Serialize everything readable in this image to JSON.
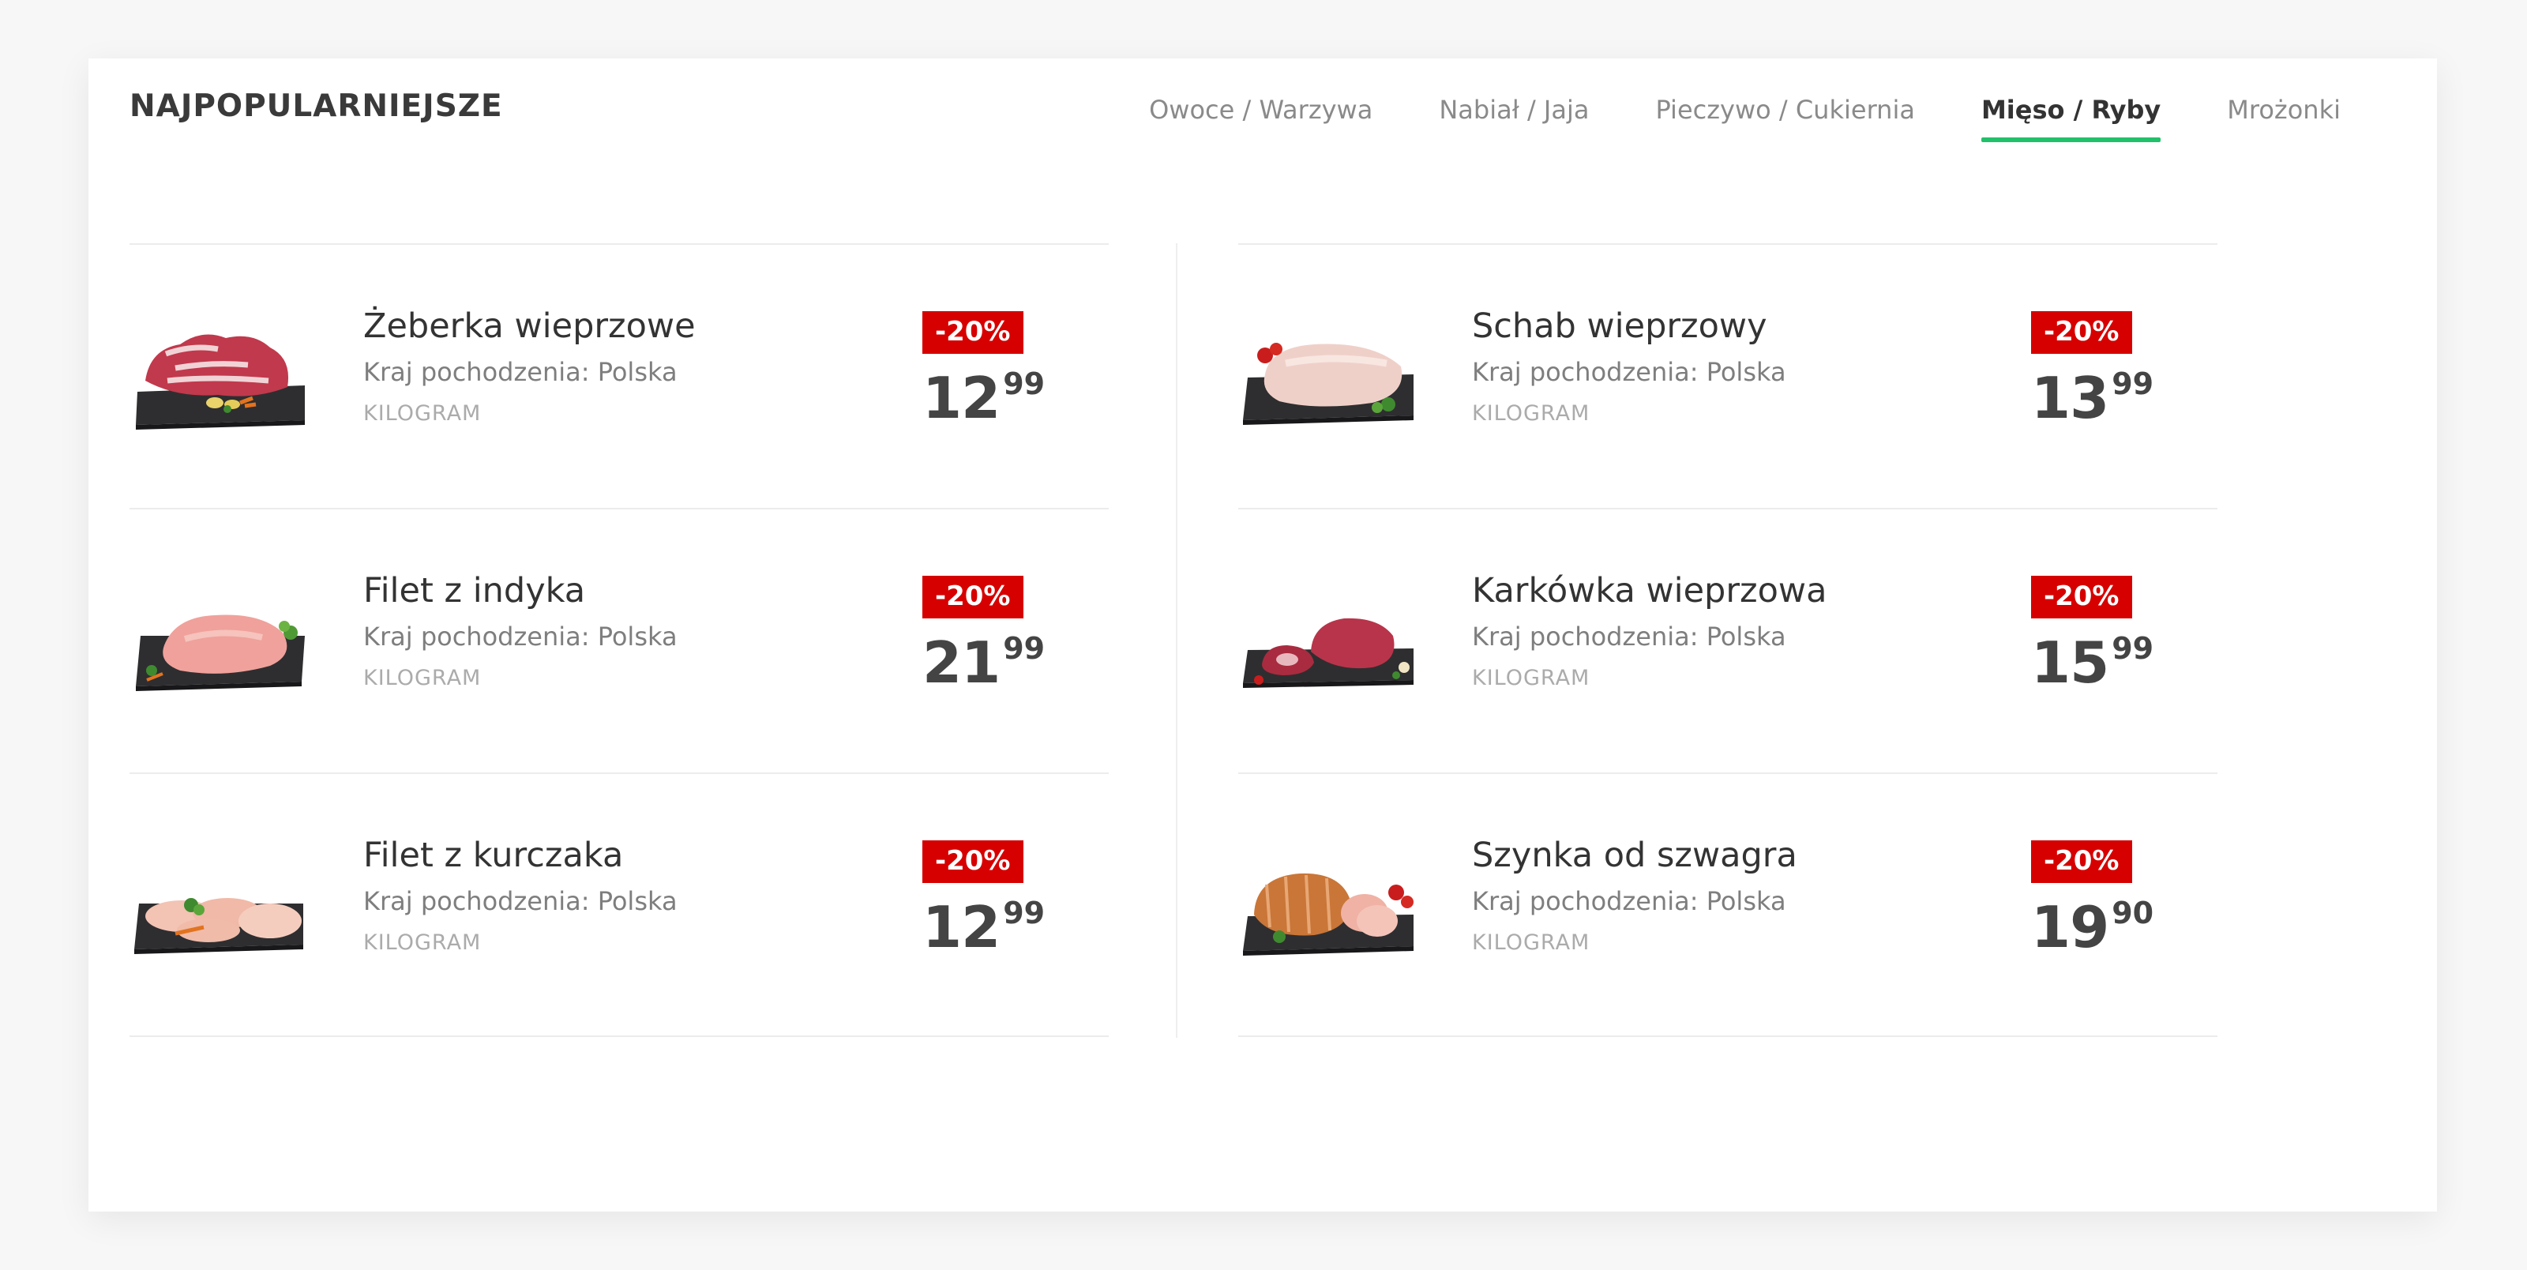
{
  "section_title": "NAJPOPULARNIEJSZE",
  "tabs": [
    {
      "label": "Owoce / Warzywa",
      "active": false
    },
    {
      "label": "Nabiał / Jaja",
      "active": false
    },
    {
      "label": "Pieczywo / Cukiernia",
      "active": false
    },
    {
      "label": "Mięso / Ryby",
      "active": true
    },
    {
      "label": "Mrożonki",
      "active": false
    }
  ],
  "colors": {
    "accent": "#22c06b",
    "badge": "#d60000",
    "text_dark": "#333333"
  },
  "products": [
    {
      "name": "Żeberka wieprzowe",
      "origin": "Kraj pochodzenia: Polska",
      "unit": "KILOGRAM",
      "discount": "-20%",
      "price_main": "12",
      "price_cents": "99",
      "image": "pork-ribs-image"
    },
    {
      "name": "Filet z indyka",
      "origin": "Kraj pochodzenia: Polska",
      "unit": "KILOGRAM",
      "discount": "-20%",
      "price_main": "21",
      "price_cents": "99",
      "image": "turkey-fillet-image"
    },
    {
      "name": "Filet z kurczaka",
      "origin": "Kraj pochodzenia: Polska",
      "unit": "KILOGRAM",
      "discount": "-20%",
      "price_main": "12",
      "price_cents": "99",
      "image": "chicken-fillet-image"
    },
    {
      "name": "Schab wieprzowy",
      "origin": "Kraj pochodzenia: Polska",
      "unit": "KILOGRAM",
      "discount": "-20%",
      "price_main": "13",
      "price_cents": "99",
      "image": "pork-loin-image"
    },
    {
      "name": "Karkówka wieprzowa",
      "origin": "Kraj pochodzenia: Polska",
      "unit": "KILOGRAM",
      "discount": "-20%",
      "price_main": "15",
      "price_cents": "99",
      "image": "pork-neck-image"
    },
    {
      "name": "Szynka od szwagra",
      "origin": "Kraj pochodzenia: Polska",
      "unit": "KILOGRAM",
      "discount": "-20%",
      "price_main": "19",
      "price_cents": "90",
      "image": "ham-image"
    }
  ]
}
